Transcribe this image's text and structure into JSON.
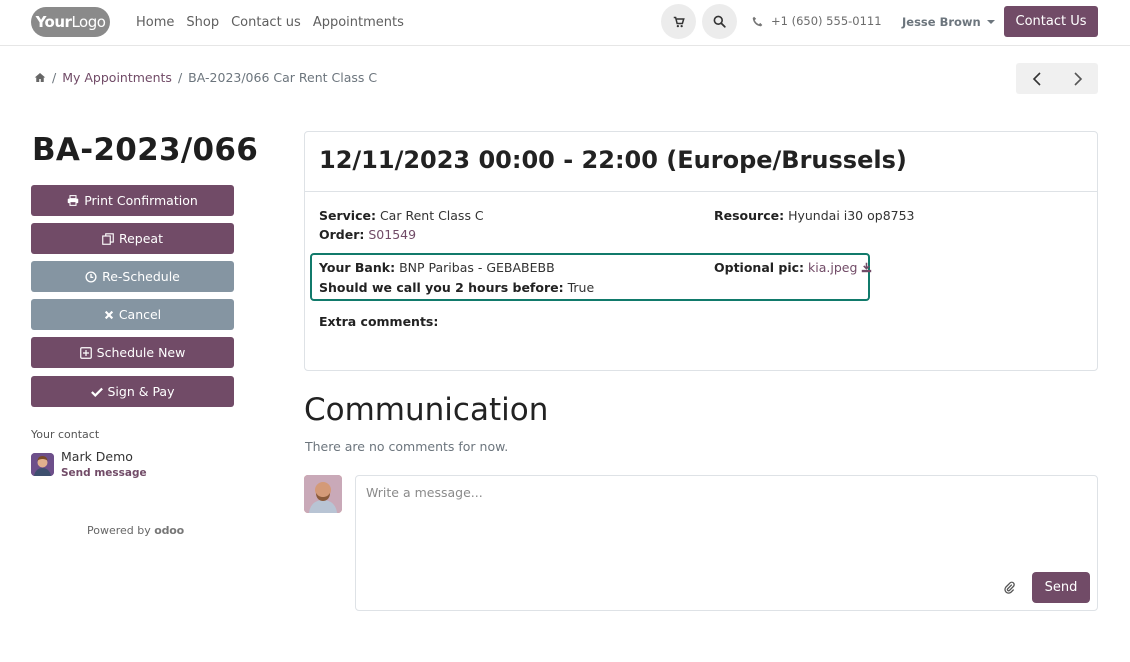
{
  "header": {
    "logo": {
      "text_bold": "Your",
      "text_rest": "Logo"
    },
    "nav": [
      "Home",
      "Shop",
      "Contact us",
      "Appointments"
    ],
    "phone": "+1 (650) 555-0111",
    "user": "Jesse Brown",
    "contact_button": "Contact Us"
  },
  "breadcrumb": {
    "home_icon": "home-icon",
    "link": "My Appointments",
    "current": "BA-2023/066 Car Rent Class C",
    "separator": "/"
  },
  "sidebar": {
    "title": "BA-2023/066",
    "buttons": [
      {
        "icon": "print-icon",
        "label": "Print Confirmation",
        "style": "primary"
      },
      {
        "icon": "copy-icon",
        "label": "Repeat",
        "style": "primary"
      },
      {
        "icon": "clock-icon",
        "label": "Re-Schedule",
        "style": "secondary"
      },
      {
        "icon": "times-icon",
        "label": "Cancel",
        "style": "secondary"
      },
      {
        "icon": "plus-square-icon",
        "label": "Schedule New",
        "style": "primary"
      },
      {
        "icon": "check-icon",
        "label": "Sign & Pay",
        "style": "primary"
      }
    ],
    "contact_label": "Your contact",
    "contact_name": "Mark Demo",
    "send_message": "Send message",
    "powered_by": "Powered by",
    "powered_brand": "odoo"
  },
  "appointment": {
    "title": "12/11/2023 00:00 - 22:00 (Europe/Brussels)",
    "service_label": "Service:",
    "service_value": "Car Rent Class C",
    "order_label": "Order:",
    "order_value": "S01549",
    "resource_label": "Resource:",
    "resource_value": "Hyundai i30 op8753",
    "bank_label": "Your Bank:",
    "bank_value": "BNP Paribas - GEBABEBB",
    "call_label": "Should we call you 2 hours before:",
    "call_value": "True",
    "pic_label": "Optional pic:",
    "pic_value": "kia.jpeg",
    "extra_label": "Extra comments:"
  },
  "communication": {
    "title": "Communication",
    "empty_text": "There are no comments for now.",
    "placeholder": "Write a message...",
    "send": "Send"
  },
  "colors": {
    "brand": "#714B67",
    "secondary": "#8595a2",
    "highlight": "#117a6b"
  }
}
